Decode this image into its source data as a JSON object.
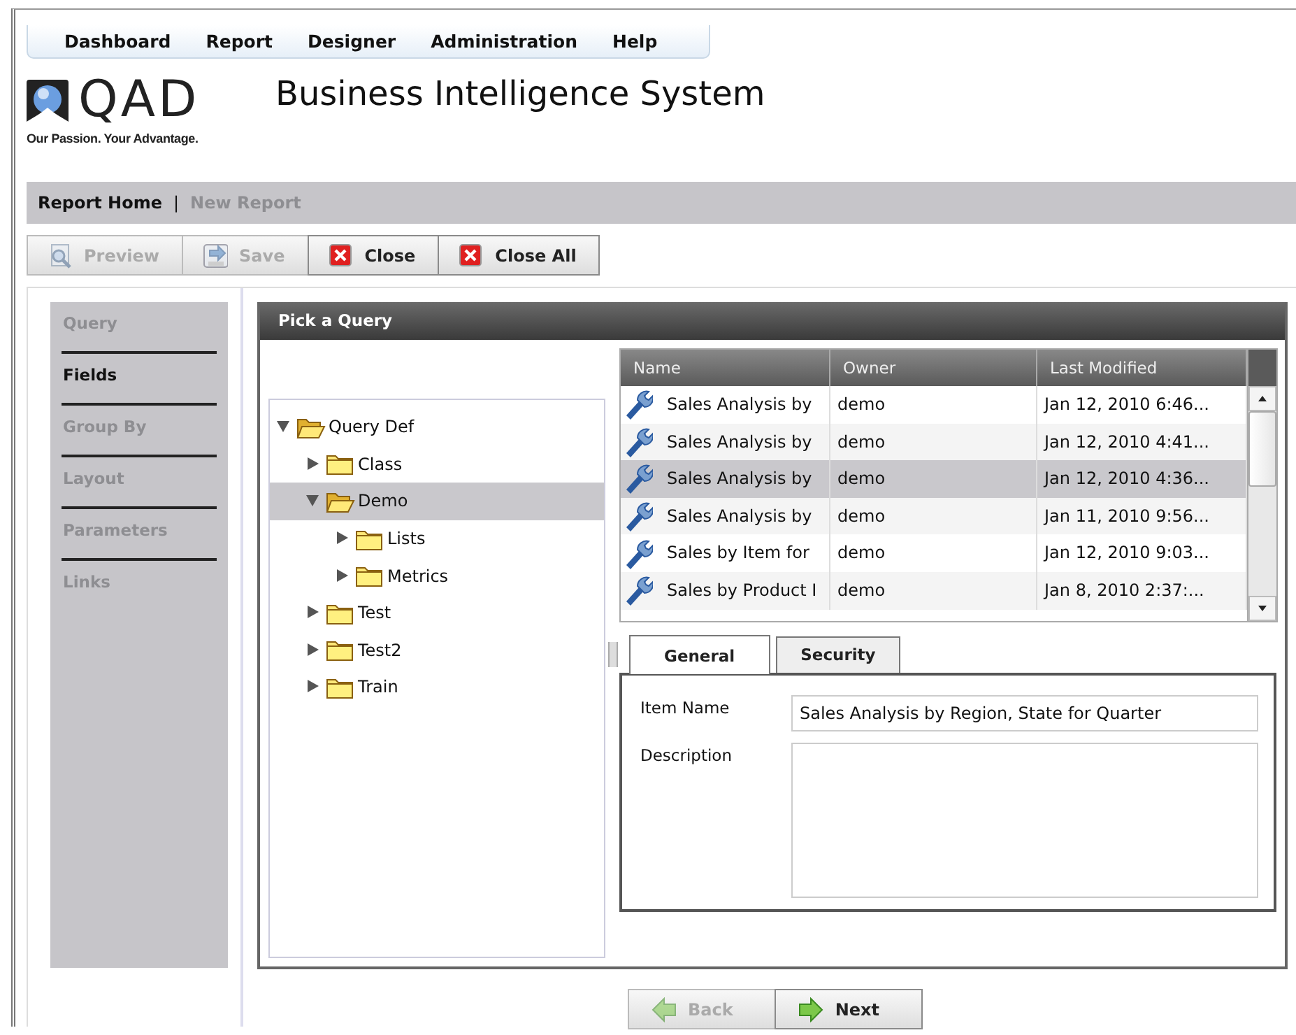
{
  "menu": [
    {
      "label": "Dashboard"
    },
    {
      "label": "Report"
    },
    {
      "label": "Designer"
    },
    {
      "label": "Administration"
    },
    {
      "label": "Help"
    }
  ],
  "logo": {
    "text": "QAD",
    "tagline": "Our Passion. Your Advantage."
  },
  "app_title": "Business Intelligence System",
  "breadcrumbs": [
    {
      "label": "Report Home",
      "disabled": false
    },
    {
      "label": "New Report",
      "disabled": true
    }
  ],
  "breadcrumb_separator": "|",
  "toolbar": [
    {
      "label": "Preview",
      "kind": "preview",
      "disabled": true
    },
    {
      "label": "Save",
      "kind": "save",
      "disabled": true
    },
    {
      "label": "Close",
      "kind": "close",
      "disabled": false
    },
    {
      "label": "Close All",
      "kind": "close",
      "disabled": false
    }
  ],
  "wizard_steps": [
    {
      "label": "Query",
      "selected": false
    },
    {
      "label": "Fields",
      "selected": true
    },
    {
      "label": "Group By",
      "selected": false
    },
    {
      "label": "Layout",
      "selected": false
    },
    {
      "label": "Parameters",
      "selected": false
    },
    {
      "label": "Links",
      "selected": false
    }
  ],
  "panel": {
    "title": "Pick a Query"
  },
  "tree": [
    {
      "label": "Query Def",
      "expanded": true,
      "selected": false,
      "children": [
        {
          "label": "Class",
          "expanded": false,
          "selected": false
        },
        {
          "label": "Demo",
          "expanded": true,
          "selected": true,
          "children": [
            {
              "label": "Lists",
              "expanded": false,
              "selected": false
            },
            {
              "label": "Metrics",
              "expanded": false,
              "selected": false
            }
          ]
        },
        {
          "label": "Test",
          "expanded": false,
          "selected": false
        },
        {
          "label": "Test2",
          "expanded": false,
          "selected": false
        },
        {
          "label": "Train",
          "expanded": false,
          "selected": false
        }
      ]
    }
  ],
  "table": {
    "columns": [
      "Name",
      "Owner",
      "Last Modified"
    ],
    "rows": [
      {
        "cells": [
          "Sales Analysis by",
          "demo",
          "Jan 12, 2010 6:46..."
        ],
        "selected": false
      },
      {
        "cells": [
          "Sales Analysis by",
          "demo",
          "Jan 12, 2010 4:41..."
        ],
        "selected": false
      },
      {
        "cells": [
          "Sales Analysis by",
          "demo",
          "Jan 12, 2010 4:36..."
        ],
        "selected": true
      },
      {
        "cells": [
          "Sales Analysis by",
          "demo",
          "Jan 11, 2010 9:56..."
        ],
        "selected": false
      },
      {
        "cells": [
          "Sales by Item for",
          "demo",
          "Jan 12, 2010 9:03..."
        ],
        "selected": false
      },
      {
        "cells": [
          "Sales by Product I",
          "demo",
          "Jan 8, 2010 2:37:..."
        ],
        "selected": false
      }
    ]
  },
  "detail_tabs": [
    {
      "label": "General",
      "selected": true
    },
    {
      "label": "Security",
      "selected": false
    }
  ],
  "form": {
    "item_name_label": "Item Name",
    "item_name": "Sales Analysis by Region, State for Quarter",
    "description_label": "Description"
  },
  "nav_buttons": [
    {
      "label": "Back",
      "kind": "back",
      "disabled": true
    },
    {
      "label": "Next",
      "kind": "next",
      "disabled": false
    }
  ]
}
